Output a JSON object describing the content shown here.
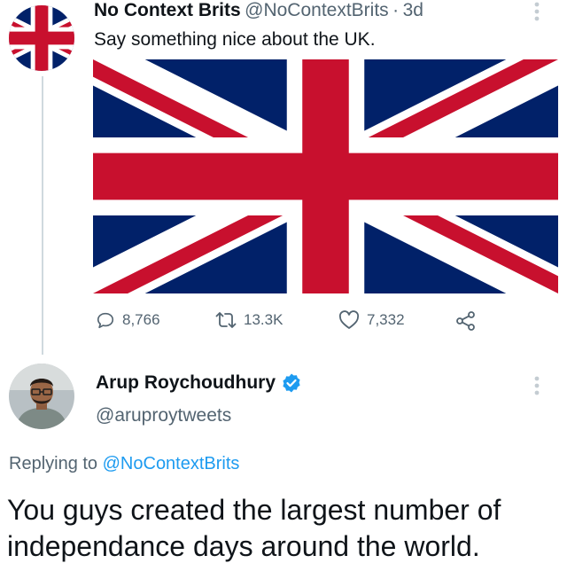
{
  "tweet1": {
    "name": "No Context Brits",
    "handle": "@NoContextBrits",
    "separator": "·",
    "time": "3d",
    "text": "Say something nice about the UK.",
    "replies": "8,766",
    "retweets": "13.3K",
    "likes": "7,332"
  },
  "tweet2": {
    "name": "Arup Roychoudhury",
    "handle": "@aruproytweets",
    "replying_prefix": "Replying to",
    "replying_handle": "@NoContextBrits",
    "text_line1": "You guys created the largest number of",
    "text_line2": "independance days around the world."
  },
  "icons": {
    "reply": "speech-bubble-icon",
    "retweet": "retweet-icon",
    "like": "heart-icon",
    "share": "share-icon",
    "verified": "verified-badge-icon",
    "more": "more-vertical-icon"
  },
  "colors": {
    "link": "#1d9bf0",
    "muted": "#536471",
    "flag_blue": "#012169",
    "flag_red": "#C8102E",
    "verified": "#1d9bf0"
  }
}
